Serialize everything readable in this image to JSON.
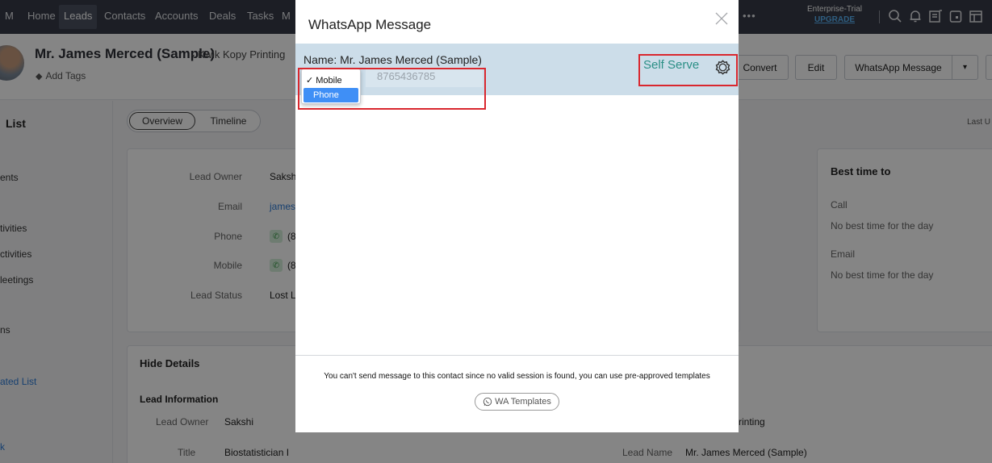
{
  "nav": {
    "brand": "M",
    "items": [
      "Home",
      "Leads",
      "Contacts",
      "Accounts",
      "Deals",
      "Tasks",
      "M"
    ],
    "more": "•••",
    "plan": "Enterprise-Trial",
    "upgrade": "UPGRADE"
  },
  "record": {
    "name": "Mr. James Merced (Sample)",
    "company": "- Kwik Kopy Printing",
    "add_tags": "Add Tags",
    "buttons": {
      "convert": "Convert",
      "edit": "Edit",
      "whatsapp": "WhatsApp Message",
      "caret": "▾"
    }
  },
  "leftlist": {
    "title": "List",
    "items": [
      "ents",
      "tivities",
      "ctivities",
      "leetings",
      "ns",
      "ated List",
      "k"
    ]
  },
  "tabs": {
    "overview": "Overview",
    "timeline": "Timeline",
    "last": "Last U"
  },
  "details": {
    "rows": [
      {
        "label": "Lead Owner",
        "value": "Saksh"
      },
      {
        "label": "Email",
        "value": "james"
      },
      {
        "label": "Phone",
        "value": "(8"
      },
      {
        "label": "Mobile",
        "value": "(8"
      },
      {
        "label": "Lead Status",
        "value": "Lost L"
      }
    ]
  },
  "best_time": {
    "title": "Best time to",
    "call_label": "Call",
    "call_value": "No best time for the day",
    "email_label": "Email",
    "email_value": "No best time for the day"
  },
  "hide_details": {
    "title": "Hide Details",
    "section": "Lead Information",
    "owner_label": "Lead Owner",
    "owner_value": "Sakshi",
    "title_label": "Title",
    "title_value": "Biostatistician I",
    "company_frag": "rinting",
    "lead_name_label": "Lead Name",
    "lead_name_value": "Mr. James Merced (Sample)"
  },
  "modal": {
    "title": "WhatsApp Message",
    "name_line": "Name: Mr. James Merced (Sample)",
    "number": "8765436785",
    "options": [
      "✓ Mobile",
      "Phone"
    ],
    "self_serve": "Self Serve",
    "footer_msg": "You can't send message to this contact since no valid session is found, you can use pre-approved templates",
    "templates_btn": "WA Templates"
  }
}
